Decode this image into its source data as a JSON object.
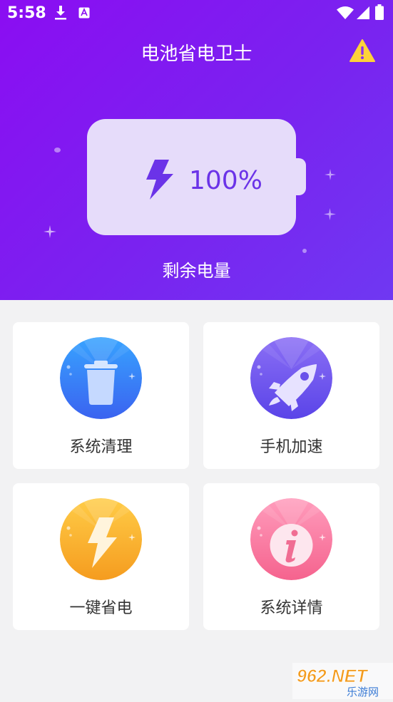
{
  "status_bar": {
    "time": "5:58"
  },
  "header": {
    "title": "电池省电卫士"
  },
  "battery": {
    "level_text": "100%",
    "level": 100,
    "caption": "剩余电量"
  },
  "features": [
    {
      "label": "系统清理",
      "icon": "trash-icon"
    },
    {
      "label": "手机加速",
      "icon": "rocket-icon"
    },
    {
      "label": "一键省电",
      "icon": "lightning-icon"
    },
    {
      "label": "系统详情",
      "icon": "info-icon"
    }
  ],
  "watermark": {
    "brand": "962.NET",
    "sub": "乐游网"
  },
  "colors": {
    "hero_start": "#8b0df2",
    "hero_end": "#6f38f2",
    "battery_fill": "#e6dcfa",
    "accent": "#6b33e8",
    "background": "#f2f2f3"
  }
}
